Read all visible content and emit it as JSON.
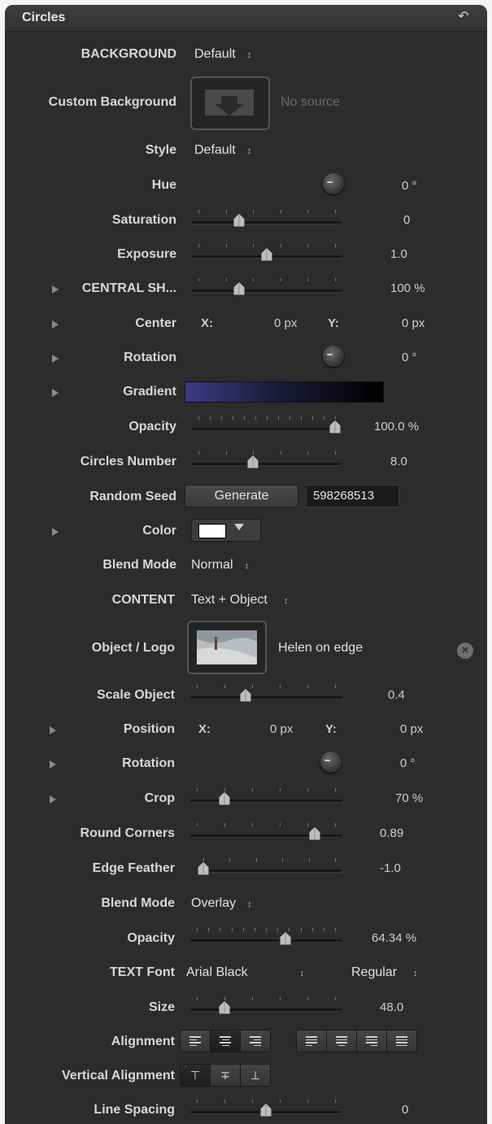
{
  "panel": {
    "title": "Circles",
    "reset_icon": "reset-arrow-icon"
  },
  "rows": {
    "background": {
      "label": "BACKGROUND",
      "value": "Default"
    },
    "custom_background": {
      "label": "Custom Background",
      "status": "No source"
    },
    "style": {
      "label": "Style",
      "value": "Default"
    },
    "hue": {
      "label": "Hue",
      "value": "0",
      "unit": "°"
    },
    "saturation": {
      "label": "Saturation",
      "value": "0",
      "level": 0.3
    },
    "exposure": {
      "label": "Exposure",
      "value": "1.0",
      "level": 0.5
    },
    "central_shape": {
      "label": "CENTRAL SH...",
      "value": "100",
      "unit": "%",
      "level": 0.3
    },
    "center": {
      "label": "Center",
      "x_label": "X:",
      "x_value": "0",
      "x_unit": "px",
      "y_label": "Y:",
      "y_value": "0",
      "y_unit": "px"
    },
    "rotation1": {
      "label": "Rotation",
      "value": "0",
      "unit": "°"
    },
    "gradient": {
      "label": "Gradient",
      "colors": [
        "#3b3b86",
        "#000000"
      ]
    },
    "opacity1": {
      "label": "Opacity",
      "value": "100.0",
      "unit": "%",
      "level": 1.0
    },
    "circles_number": {
      "label": "Circles Number",
      "value": "8.0",
      "level": 0.4
    },
    "random_seed": {
      "label": "Random Seed",
      "button": "Generate",
      "seed": "598268513"
    },
    "color": {
      "label": "Color",
      "swatch": "#ffffff"
    },
    "blend_mode1": {
      "label": "Blend Mode",
      "value": "Normal"
    },
    "content": {
      "label": "CONTENT",
      "value": "Text + Object"
    },
    "object_logo": {
      "label": "Object / Logo",
      "name": "Helen on edge"
    },
    "scale_object": {
      "label": "Scale Object",
      "value": "0.4",
      "level": 0.35
    },
    "position": {
      "label": "Position",
      "x_label": "X:",
      "x_value": "0",
      "x_unit": "px",
      "y_label": "Y:",
      "y_value": "0",
      "y_unit": "px"
    },
    "rotation2": {
      "label": "Rotation",
      "value": "0",
      "unit": "°"
    },
    "crop": {
      "label": "Crop",
      "value": "70",
      "unit": "%",
      "level": 0.2
    },
    "round_corners": {
      "label": "Round Corners",
      "value": "0.89",
      "level": 0.85
    },
    "edge_feather": {
      "label": "Edge Feather",
      "value": "-1.0",
      "level": 0.0
    },
    "blend_mode2": {
      "label": "Blend Mode",
      "value": "Overlay"
    },
    "opacity2": {
      "label": "Opacity",
      "value": "64.34",
      "unit": "%",
      "level": 0.64
    },
    "text_font": {
      "label": "TEXT Font",
      "value": "Arial Black",
      "style": "Regular"
    },
    "size": {
      "label": "Size",
      "value": "48.0",
      "level": 0.2
    },
    "alignment": {
      "label": "Alignment"
    },
    "vertical_alignment": {
      "label": "Vertical Alignment"
    },
    "line_spacing": {
      "label": "Line Spacing",
      "value": "0",
      "level": 0.5
    }
  }
}
